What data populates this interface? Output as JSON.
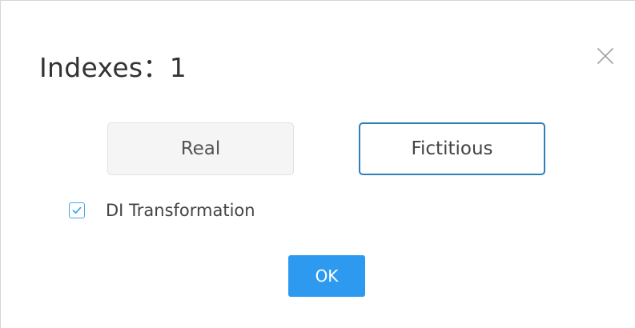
{
  "dialog": {
    "title": "Indexes：1",
    "close_icon": "close-icon",
    "options": [
      {
        "label": "Real",
        "selected": false
      },
      {
        "label": "Fictitious",
        "selected": true
      }
    ],
    "checkbox": {
      "label": "DI Transformation",
      "checked": true,
      "icon": "checkmark-icon"
    },
    "ok_label": "OK"
  },
  "colors": {
    "accent": "#2d9af0",
    "selected_border": "#2f7fb8",
    "checkbox_border": "#4aa8e6",
    "unselected_bg": "#f5f5f5"
  }
}
